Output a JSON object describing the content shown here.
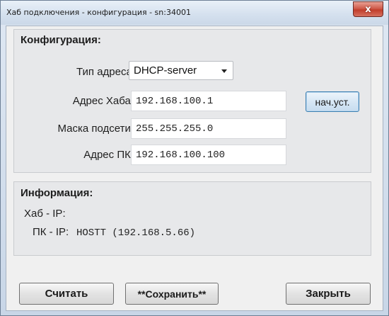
{
  "window": {
    "title": "Хаб подключения - конфигурация -  sn:34001",
    "close_glyph": "x"
  },
  "config": {
    "heading": "Конфигурация:",
    "address_type_label": "Тип адреса:",
    "address_type_value": "DHCP-server",
    "hub_address_label": "Адрес Хаба:",
    "hub_address_value": "192.168.100.1",
    "reset_button_label": "нач.уст.",
    "subnet_mask_label": "Маска подсети:",
    "subnet_mask_value": "255.255.255.0",
    "pc_address_label": "Адрес ПК:",
    "pc_address_value": "192.168.100.100"
  },
  "info": {
    "heading": "Информация:",
    "hub_ip_label": "Хаб - IP:",
    "hub_ip_value": "",
    "pc_ip_label": "ПК - IP:",
    "pc_ip_value": "HOSTT (192.168.5.66)"
  },
  "buttons": {
    "read": "Считать",
    "save": "**Сохранить**",
    "close": "Закрыть"
  }
}
